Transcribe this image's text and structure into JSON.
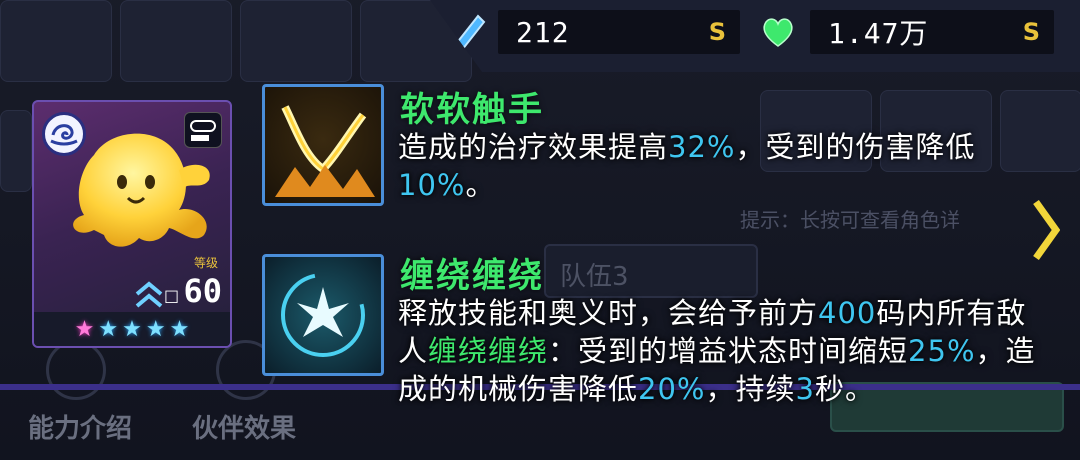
{
  "currency": [
    {
      "icon": "blue-crystal-icon",
      "value": "212",
      "unit": "S"
    },
    {
      "icon": "green-heart-icon",
      "value": "1.47万",
      "unit": "S"
    }
  ],
  "background": {
    "hint": "提示：长按可查看角色详",
    "team_label": "队伍3",
    "tabs": [
      "能力介绍",
      "伙伴效果"
    ]
  },
  "card": {
    "level_label": "等级",
    "level": "60",
    "rank_suffix": "□",
    "stars": 5
  },
  "skills": [
    {
      "name": "软软触手",
      "desc": [
        {
          "t": "造成的治疗效果提高",
          "h": false
        },
        {
          "t": "32%",
          "h": true
        },
        {
          "t": "，受到的伤害降低",
          "h": false
        },
        {
          "t": "10%",
          "h": true
        },
        {
          "t": "。",
          "h": false
        }
      ]
    },
    {
      "name": "缠绕缠绕",
      "desc": [
        {
          "t": "释放技能和奥义时，会给予前方",
          "h": false
        },
        {
          "t": "400",
          "h": true
        },
        {
          "t": "码内所有敌人",
          "h": false
        },
        {
          "t": "缠绕缠绕",
          "h": true
        },
        {
          "t": "：受到的增益状态时间缩短",
          "h": false
        },
        {
          "t": "25%",
          "h": true
        },
        {
          "t": "，造成的机械伤害降低",
          "h": false
        },
        {
          "t": "20%",
          "h": true
        },
        {
          "t": "，持续",
          "h": false
        },
        {
          "t": "3",
          "h": true
        },
        {
          "t": "秒。",
          "h": false
        }
      ]
    }
  ],
  "colors": {
    "skill_name": "#3ee86d",
    "highlight": "#3fc6f0",
    "currency_unit": "#e9c23b"
  }
}
